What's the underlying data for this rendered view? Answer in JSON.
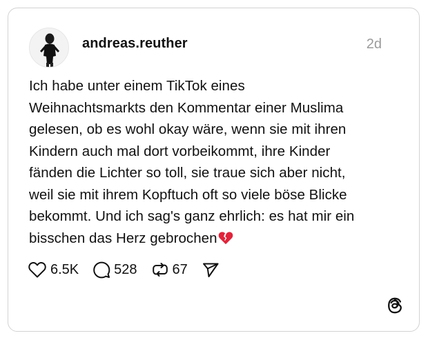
{
  "post": {
    "username": "andreas.reuther",
    "timestamp": "2d",
    "text": "Ich habe unter einem TikTok eines\nWeihnachtsmarkts den Kommentar einer Muslima\ngelesen, ob es wohl okay wäre, wenn sie mit ihren\nKindern auch mal dort vorbeikommt, ihre Kinder\nfänden die Lichter so toll, sie traue sich aber nicht,\nweil sie mit ihrem Kopftuch oft so viele böse Blicke\nbekommt. Und ich sag's ganz ehrlich: es hat mir ein\nbisschen das Herz gebrochen",
    "emoji": "broken-heart-emoji"
  },
  "actions": {
    "likes": "6.5K",
    "replies": "528",
    "reposts": "67"
  },
  "icons": {
    "like": "heart-icon",
    "reply": "comment-bubble-icon",
    "repost": "repost-icon",
    "share": "send-icon",
    "brand": "threads-logo-icon"
  },
  "colors": {
    "text": "#111111",
    "muted": "#9a9a9a",
    "border": "#d2d2d2",
    "emoji_red": "#e0243a"
  }
}
